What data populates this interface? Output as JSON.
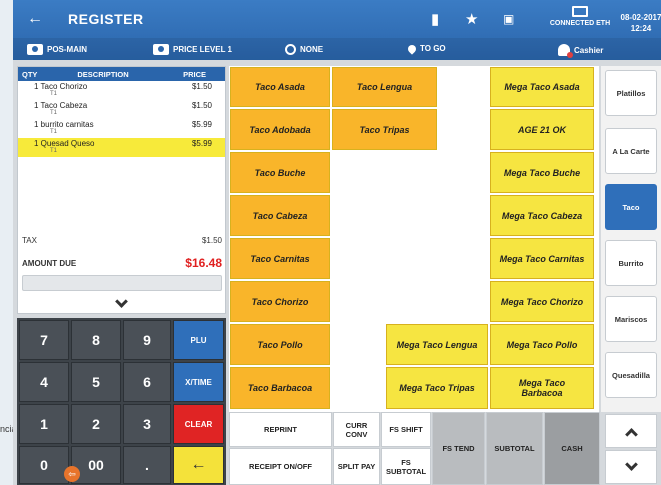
{
  "header": {
    "title": "REGISTER",
    "datetime_date": "08-02-2017",
    "datetime_time": "12:24",
    "connected": "CONNECTED ETH",
    "terminal": "POS-MAIN",
    "price_level": "PRICE LEVEL 1",
    "none": "NONE",
    "to_go": "TO GO",
    "cashier": "Cashier"
  },
  "order": {
    "col_qty": "QTY",
    "col_desc": "DESCRIPTION",
    "col_price": "PRICE",
    "lines": [
      {
        "qd": "1 Taco Chorizo",
        "price": "$1.50",
        "sub": "T1"
      },
      {
        "qd": "1 Taco Cabeza",
        "price": "$1.50",
        "sub": "T1"
      },
      {
        "qd": "1 burrito carnitas",
        "price": "$5.99",
        "sub": "T1"
      },
      {
        "qd": "1 Quesad Queso",
        "price": "$5.99",
        "sub": "T1"
      }
    ],
    "tax_label": "TAX",
    "tax_value": "$1.50",
    "due_label": "AMOUNT DUE",
    "due_value": "$16.48"
  },
  "keypad": {
    "k7": "7",
    "k8": "8",
    "k9": "9",
    "plu": "PLU",
    "k4": "4",
    "k5": "5",
    "k6": "6",
    "xtime": "X/TIME",
    "k1": "1",
    "k2": "2",
    "k3": "3",
    "clear": "CLEAR",
    "k0": "0",
    "k00": "00",
    "dot": ".",
    "enter": "←"
  },
  "items": {
    "taco_asada": "Taco Asada",
    "taco_lengua": "Taco Lengua",
    "mega_taco_asada": "Mega Taco Asada",
    "taco_adobada": "Taco Adobada",
    "taco_tripas": "Taco Tripas",
    "age_21": "AGE 21 OK",
    "taco_buche": "Taco Buche",
    "mega_taco_buche": "Mega Taco Buche",
    "taco_cabeza": "Taco Cabeza",
    "mega_taco_cabeza": "Mega Taco Cabeza",
    "taco_carnitas": "Taco Carnitas",
    "mega_taco_carnitas": "Mega Taco Carnitas",
    "taco_chorizo": "Taco Chorizo",
    "mega_taco_chorizo": "Mega Taco Chorizo",
    "taco_pollo": "Taco Pollo",
    "mega_taco_lengua": "Mega Taco Lengua",
    "mega_taco_pollo": "Mega Taco Pollo",
    "taco_barbacoa": "Taco Barbacoa",
    "mega_taco_tripas": "Mega Taco Tripas",
    "mega_taco_barbacoa": "Mega Taco Barbacoa"
  },
  "categories": {
    "platillos": "Platillos",
    "a_la_carte": "A La Carte",
    "taco": "Taco",
    "burrito": "Burrito",
    "mariscos": "Mariscos",
    "quesadilla": "Quesadilla"
  },
  "functions": {
    "reprint": "REPRINT",
    "curr_conv": "CURR CONV",
    "fs_shift": "FS SHIFT",
    "fs_tend": "FS TEND",
    "subtotal": "SUBTOTAL",
    "cash": "CASH",
    "receipt": "RECEIPT ON/OFF",
    "split_pay": "SPLIT PAY",
    "fs_subtotal": "FS SUBTOTAL"
  },
  "badge": "⇦",
  "left_stub": "ncia"
}
